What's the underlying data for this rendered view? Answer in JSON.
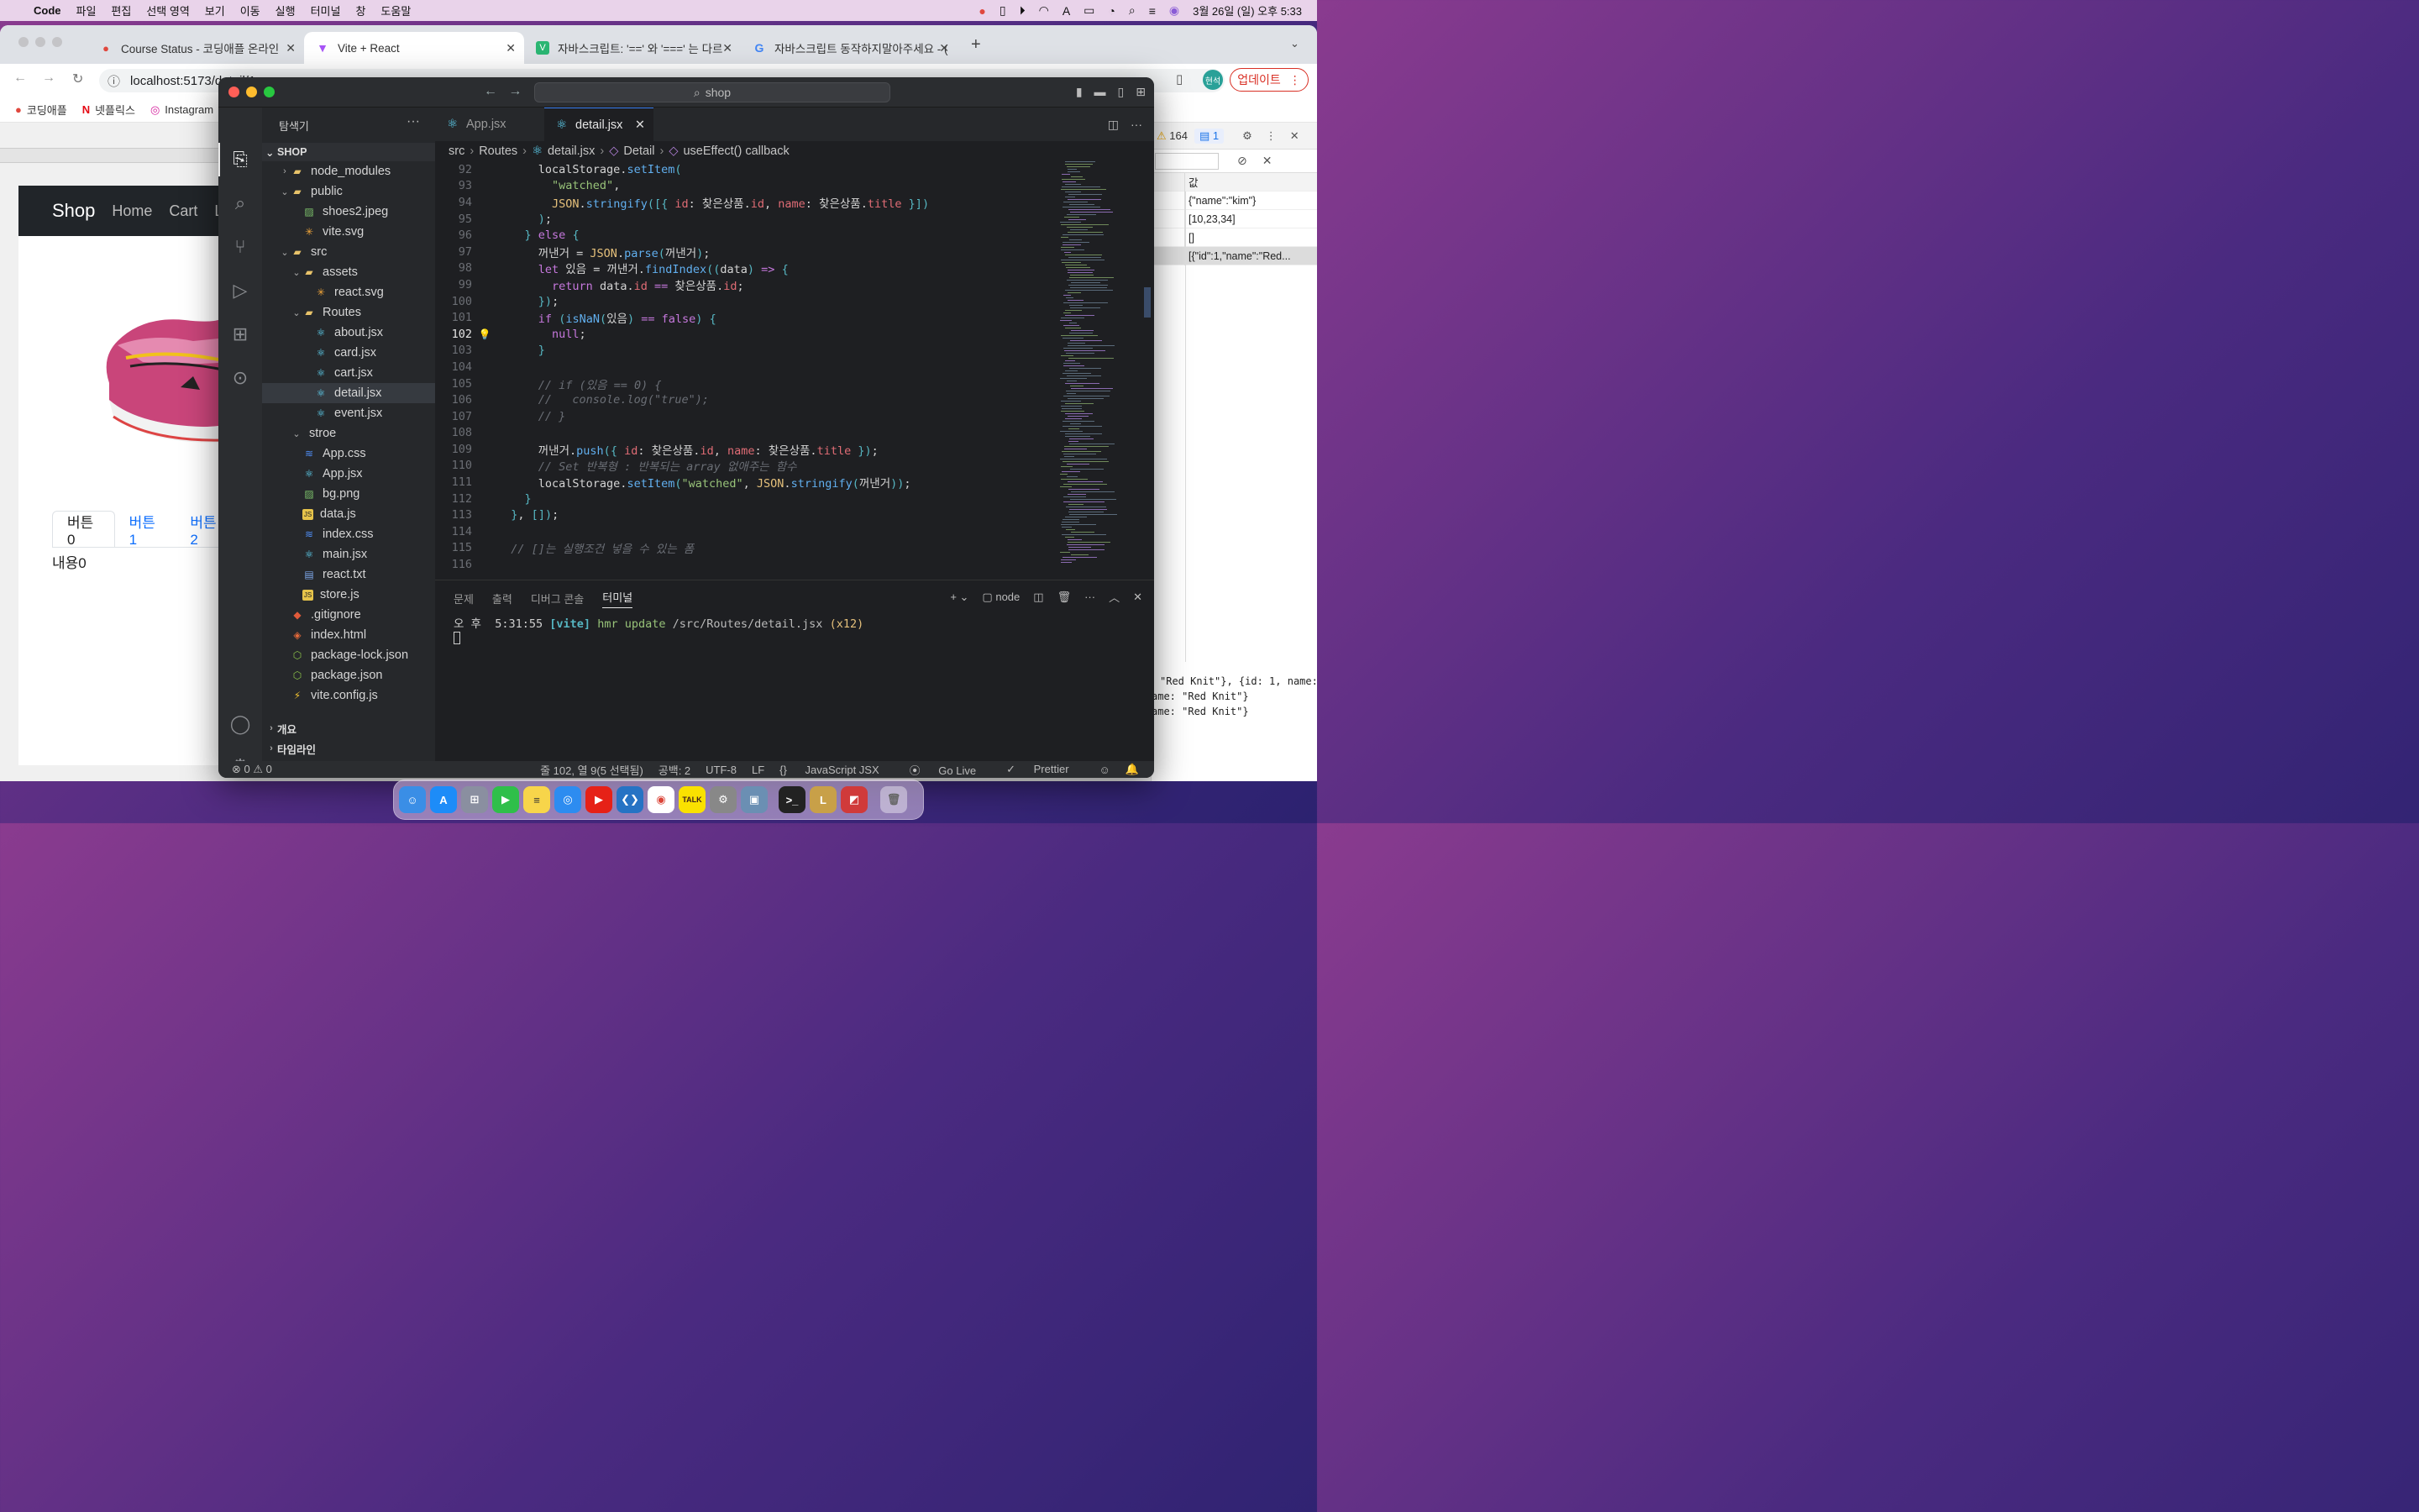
{
  "menubar": {
    "app_name": "Code",
    "items": [
      "파일",
      "편집",
      "선택 영역",
      "보기",
      "이동",
      "실행",
      "터미널",
      "창",
      "도움말"
    ],
    "clock": "3월 26일 (일) 오후 5:33"
  },
  "browser": {
    "tabs": [
      {
        "title": "Course Status - 코딩애플 온라인",
        "active": false
      },
      {
        "title": "Vite + React",
        "active": true
      },
      {
        "title": "자바스크립트: '==' 와 '===' 는 다르",
        "active": false
      },
      {
        "title": "자바스크립트 동작하지말아주세요 - (",
        "active": false
      }
    ],
    "new_tab": "+",
    "url": "localhost:5173/detail/1",
    "profile": "현석",
    "update_label": "업데이트",
    "bookmarks": [
      "코딩애플",
      "넷플릭스",
      "Instagram"
    ]
  },
  "page": {
    "brand": "Shop",
    "nav_links": [
      "Home",
      "Cart",
      "L"
    ],
    "tabs": [
      "버튼0",
      "버튼1",
      "버튼2"
    ],
    "content": "내용0"
  },
  "devtools": {
    "warnings": "164",
    "messages": "1",
    "value_header": "값",
    "values": [
      "{\"name\":\"kim\"}",
      "[10,23,34]",
      "[]",
      "[{\"id\":1,\"name\":\"Red..."
    ],
    "console_lines": [
      "\"Red Knit\"}, {id: 1, name:",
      "ame: \"Red Knit\"}",
      "ame: \"Red Knit\"}"
    ]
  },
  "vscode": {
    "search": "shop",
    "explorer_title": "탐색기",
    "root": "SHOP",
    "tree": [
      {
        "label": "node_modules",
        "icon": "folder",
        "depth": 1,
        "chev": "›"
      },
      {
        "label": "public",
        "icon": "folder",
        "depth": 1,
        "chev": "⌄"
      },
      {
        "label": "shoes2.jpeg",
        "icon": "img",
        "depth": 2,
        "chev": ""
      },
      {
        "label": "vite.svg",
        "icon": "star",
        "depth": 2,
        "chev": ""
      },
      {
        "label": "src",
        "icon": "folder",
        "depth": 1,
        "chev": "⌄"
      },
      {
        "label": "assets",
        "icon": "folder",
        "depth": 2,
        "chev": "⌄"
      },
      {
        "label": "react.svg",
        "icon": "star",
        "depth": 3,
        "chev": ""
      },
      {
        "label": "Routes",
        "icon": "folder",
        "depth": 2,
        "chev": "⌄"
      },
      {
        "label": "about.jsx",
        "icon": "react",
        "depth": 3,
        "chev": ""
      },
      {
        "label": "card.jsx",
        "icon": "react",
        "depth": 3,
        "chev": ""
      },
      {
        "label": "cart.jsx",
        "icon": "react",
        "depth": 3,
        "chev": ""
      },
      {
        "label": "detail.jsx",
        "icon": "react",
        "depth": 3,
        "chev": "",
        "selected": true
      },
      {
        "label": "event.jsx",
        "icon": "react",
        "depth": 3,
        "chev": ""
      },
      {
        "label": "stroe",
        "icon": "none",
        "depth": 2,
        "chev": "⌄"
      },
      {
        "label": "App.css",
        "icon": "css",
        "depth": 2,
        "chev": ""
      },
      {
        "label": "App.jsx",
        "icon": "react",
        "depth": 2,
        "chev": ""
      },
      {
        "label": "bg.png",
        "icon": "img",
        "depth": 2,
        "chev": ""
      },
      {
        "label": "data.js",
        "icon": "js",
        "depth": 2,
        "chev": ""
      },
      {
        "label": "index.css",
        "icon": "css",
        "depth": 2,
        "chev": ""
      },
      {
        "label": "main.jsx",
        "icon": "react",
        "depth": 2,
        "chev": ""
      },
      {
        "label": "react.txt",
        "icon": "txt",
        "depth": 2,
        "chev": ""
      },
      {
        "label": "store.js",
        "icon": "js",
        "depth": 2,
        "chev": ""
      },
      {
        "label": ".gitignore",
        "icon": "git",
        "depth": 1,
        "chev": ""
      },
      {
        "label": "index.html",
        "icon": "html",
        "depth": 1,
        "chev": ""
      },
      {
        "label": "package-lock.json",
        "icon": "npm",
        "depth": 1,
        "chev": ""
      },
      {
        "label": "package.json",
        "icon": "npm",
        "depth": 1,
        "chev": ""
      },
      {
        "label": "vite.config.js",
        "icon": "vite",
        "depth": 1,
        "chev": ""
      }
    ],
    "outline": "개요",
    "timeline": "타임라인",
    "tabs": [
      "App.jsx",
      "detail.jsx"
    ],
    "breadcrumbs": [
      "src",
      "Routes",
      "detail.jsx",
      "Detail",
      "useEffect() callback"
    ],
    "code_lines": [
      {
        "n": "92",
        "text": "      localStorage.setItem("
      },
      {
        "n": "93",
        "text": "        \"watched\","
      },
      {
        "n": "94",
        "text": "        JSON.stringify([{ id: 찾은상품.id, name: 찾은상품.title }])"
      },
      {
        "n": "95",
        "text": "      );"
      },
      {
        "n": "96",
        "text": "    } else {"
      },
      {
        "n": "97",
        "text": "      꺼낸거 = JSON.parse(꺼낸거);"
      },
      {
        "n": "98",
        "text": "      let 있음 = 꺼낸거.findIndex((data) => {"
      },
      {
        "n": "99",
        "text": "        return data.id == 찾은상품.id;"
      },
      {
        "n": "100",
        "text": "      });"
      },
      {
        "n": "101",
        "text": "      if (isNaN(있음) == false) {"
      },
      {
        "n": "102",
        "text": "        null;"
      },
      {
        "n": "103",
        "text": "      }"
      },
      {
        "n": "104",
        "text": ""
      },
      {
        "n": "105",
        "text": "      // if (있음 == 0) {"
      },
      {
        "n": "106",
        "text": "      //   console.log(\"true\");"
      },
      {
        "n": "107",
        "text": "      // }"
      },
      {
        "n": "108",
        "text": ""
      },
      {
        "n": "109",
        "text": "      꺼낸거.push({ id: 찾은상품.id, name: 찾은상품.title });"
      },
      {
        "n": "110",
        "text": "      // Set 반복형 : 반복되는 array 없애주는 함수"
      },
      {
        "n": "111",
        "text": "      localStorage.setItem(\"watched\", JSON.stringify(꺼낸거));"
      },
      {
        "n": "112",
        "text": "    }"
      },
      {
        "n": "113",
        "text": "  }, []);"
      },
      {
        "n": "114",
        "text": ""
      },
      {
        "n": "115",
        "text": "  // []는 실행조건 넣을 수 있는 폼"
      },
      {
        "n": "116",
        "text": ""
      }
    ],
    "panel_tabs": [
      "문제",
      "출력",
      "디버그 콘솔",
      "터미널"
    ],
    "terminal_shell": "node",
    "terminal_time": "오 후  5:31:55",
    "terminal_tag": "[vite]",
    "terminal_msg": "hmr update",
    "terminal_path": "/src/Routes/detail.jsx",
    "terminal_count": "(x12)",
    "status": {
      "errors": "0",
      "warnings": "0",
      "cursor": "줄 102, 열 9(5 선택됨)",
      "spaces": "공백: 2",
      "encoding": "UTF-8",
      "eol": "LF",
      "language": "JavaScript JSX",
      "golive": "Go Live",
      "prettier": "Prettier"
    }
  },
  "dock": {
    "apps": [
      "Finder",
      "App Store",
      "Launchpad",
      "FaceTime",
      "Notes",
      "Safari",
      "YouTube",
      "VS Code",
      "Chrome",
      "KakaoTalk",
      "System Settings",
      "Preview",
      "Terminal",
      "League",
      "Photo Booth",
      "Trash"
    ],
    "kakao_label": "TALK"
  }
}
